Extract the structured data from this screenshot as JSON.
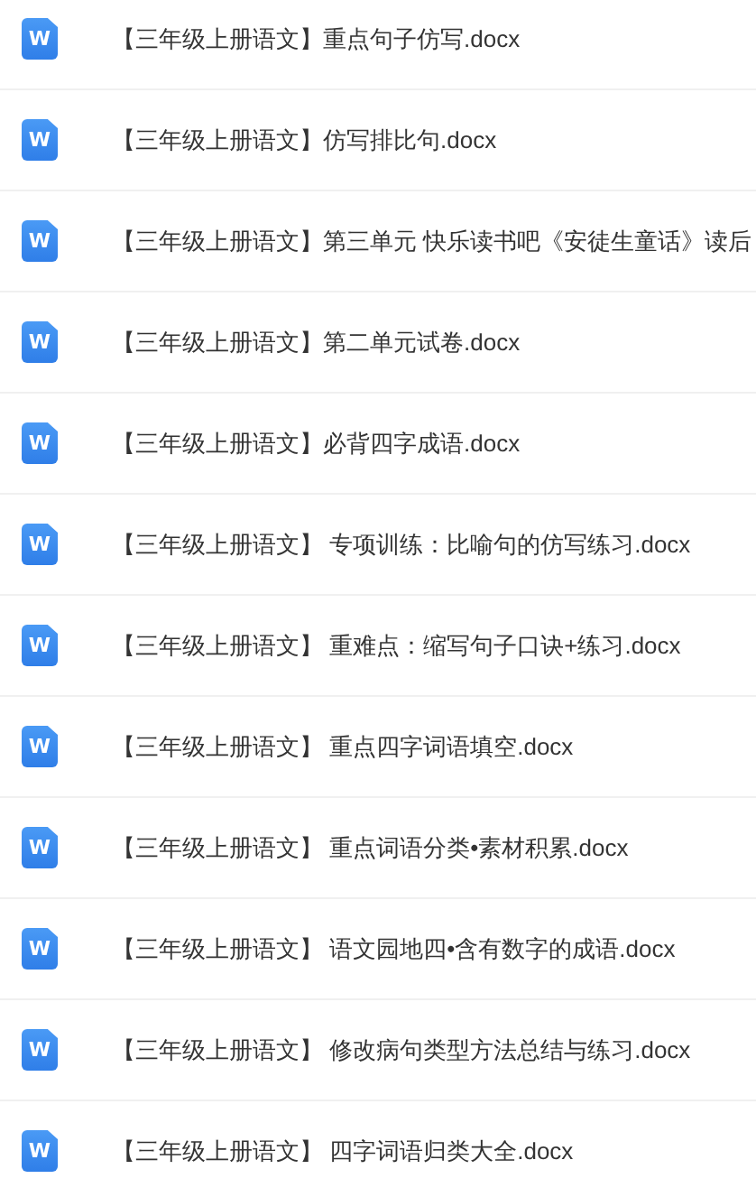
{
  "files": [
    {
      "icon": "W",
      "name": "【三年级上册语文】重点句子仿写.docx"
    },
    {
      "icon": "W",
      "name": "【三年级上册语文】仿写排比句.docx"
    },
    {
      "icon": "W",
      "name": "【三年级上册语文】第三单元 快乐读书吧《安徒生童话》读后"
    },
    {
      "icon": "W",
      "name": "【三年级上册语文】第二单元试卷.docx"
    },
    {
      "icon": "W",
      "name": "【三年级上册语文】必背四字成语.docx"
    },
    {
      "icon": "W",
      "name": "【三年级上册语文】 专项训练：比喻句的仿写练习.docx"
    },
    {
      "icon": "W",
      "name": "【三年级上册语文】 重难点：缩写句子口诀+练习.docx"
    },
    {
      "icon": "W",
      "name": "【三年级上册语文】 重点四字词语填空.docx"
    },
    {
      "icon": "W",
      "name": "【三年级上册语文】 重点词语分类•素材积累.docx"
    },
    {
      "icon": "W",
      "name": "【三年级上册语文】 语文园地四•含有数字的成语.docx"
    },
    {
      "icon": "W",
      "name": "【三年级上册语文】 修改病句类型方法总结与练习.docx"
    },
    {
      "icon": "W",
      "name": "【三年级上册语文】 四字词语归类大全.docx"
    }
  ]
}
